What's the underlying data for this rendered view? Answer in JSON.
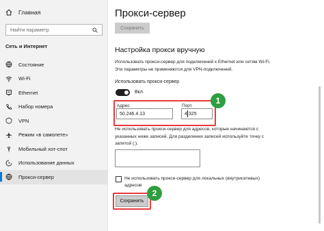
{
  "sidebar": {
    "home_label": "Главная",
    "search_placeholder": "Найти параметр",
    "section_title": "Сеть и Интернет",
    "items": [
      {
        "label": "Состояние",
        "icon": "globe-icon"
      },
      {
        "label": "Wi-Fi",
        "icon": "wifi-icon"
      },
      {
        "label": "Ethernet",
        "icon": "ethernet-icon"
      },
      {
        "label": "Набор номера",
        "icon": "dialup-icon"
      },
      {
        "label": "VPN",
        "icon": "vpn-icon"
      },
      {
        "label": "Режим «в самолете»",
        "icon": "airplane-icon"
      },
      {
        "label": "Мобильный хот-спот",
        "icon": "hotspot-icon"
      },
      {
        "label": "Использование данных",
        "icon": "data-usage-icon"
      },
      {
        "label": "Прокси-сервер",
        "icon": "proxy-icon"
      }
    ]
  },
  "main": {
    "title": "Прокси-сервер",
    "top_save_label": "Сохранить",
    "manual_heading": "Настройка прокси вручную",
    "manual_description": "Использовать прокси-сервер для подключений к Ethernet или сетям Wi-Fi. Эти параметры не применяются для VPN-подключений.",
    "use_proxy_label": "Использовать прокси-сервер",
    "toggle_state": "Вкл.",
    "address_label": "Адрес",
    "address_value": "50.246.4.13",
    "port_label": "Порт",
    "port_value_prefix": "4",
    "port_value_suffix": "325",
    "exceptions_description": "Не использовать прокси-сервер для адресов, которые начинаются с указанных ниже записей. Для разделения записей используйте точку с запятой (;).",
    "exceptions_value": "",
    "local_bypass_label": "Не использовать прокси-сервер для локальных (внутрисетевых) адресов",
    "local_bypass_checked": false,
    "save_label": "Сохранить"
  },
  "annotations": {
    "badge1": "1",
    "badge2": "2"
  },
  "colors": {
    "highlight": "#e8383d",
    "badge": "#2f9e41",
    "accent": "#0078d7"
  }
}
